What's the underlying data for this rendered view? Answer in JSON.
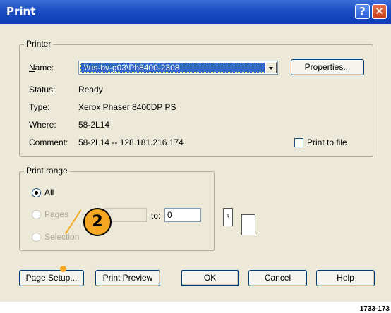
{
  "window": {
    "title": "Print",
    "help_glyph": "?",
    "close_glyph": "✕"
  },
  "printer": {
    "legend": "Printer",
    "name_label": "Name:",
    "name_value": "\\\\us-bv-g03\\Ph8400-2308",
    "properties_label": "Properties...",
    "status_label": "Status:",
    "status_value": "Ready",
    "type_label": "Type:",
    "type_value": "Xerox Phaser 8400DP PS",
    "where_label": "Where:",
    "where_value": "58-2L14",
    "comment_label": "Comment:",
    "comment_value": "58-2L14 -- 128.181.216.174",
    "print_to_file_label": "Print to file"
  },
  "print_range": {
    "legend": "Print range",
    "all_label": "All",
    "pages_label": "Pages",
    "selection_label": "Selection",
    "to_label": "to:",
    "to_value": "0",
    "selected": "All"
  },
  "copies": {
    "icon_number": "3"
  },
  "buttons": {
    "page_setup": "Page Setup...",
    "print_preview": "Print Preview",
    "ok": "OK",
    "cancel": "Cancel",
    "help": "Help"
  },
  "annotation": {
    "callout_number": "2",
    "figure_id": "1733-173"
  },
  "colors": {
    "titlebar": "#0b3cb5",
    "dialog_bg": "#ece9d8",
    "callout": "#f5a623"
  }
}
